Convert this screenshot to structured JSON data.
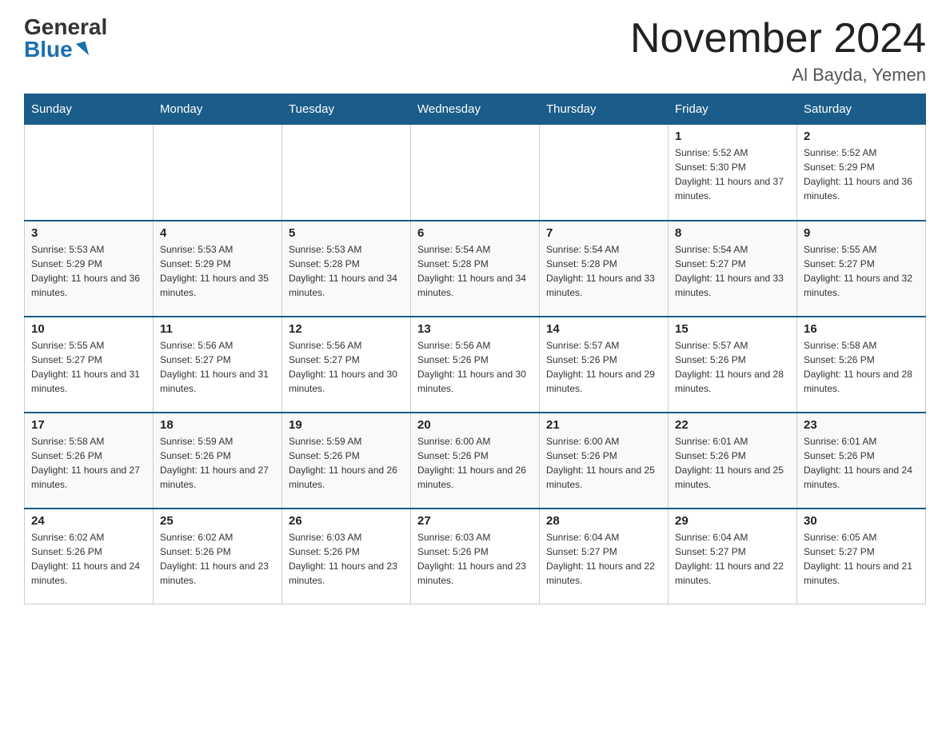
{
  "logo": {
    "general": "General",
    "blue": "Blue"
  },
  "title": "November 2024",
  "location": "Al Bayda, Yemen",
  "days_of_week": [
    "Sunday",
    "Monday",
    "Tuesday",
    "Wednesday",
    "Thursday",
    "Friday",
    "Saturday"
  ],
  "weeks": [
    [
      {
        "day": "",
        "sunrise": "",
        "sunset": "",
        "daylight": ""
      },
      {
        "day": "",
        "sunrise": "",
        "sunset": "",
        "daylight": ""
      },
      {
        "day": "",
        "sunrise": "",
        "sunset": "",
        "daylight": ""
      },
      {
        "day": "",
        "sunrise": "",
        "sunset": "",
        "daylight": ""
      },
      {
        "day": "",
        "sunrise": "",
        "sunset": "",
        "daylight": ""
      },
      {
        "day": "1",
        "sunrise": "Sunrise: 5:52 AM",
        "sunset": "Sunset: 5:30 PM",
        "daylight": "Daylight: 11 hours and 37 minutes."
      },
      {
        "day": "2",
        "sunrise": "Sunrise: 5:52 AM",
        "sunset": "Sunset: 5:29 PM",
        "daylight": "Daylight: 11 hours and 36 minutes."
      }
    ],
    [
      {
        "day": "3",
        "sunrise": "Sunrise: 5:53 AM",
        "sunset": "Sunset: 5:29 PM",
        "daylight": "Daylight: 11 hours and 36 minutes."
      },
      {
        "day": "4",
        "sunrise": "Sunrise: 5:53 AM",
        "sunset": "Sunset: 5:29 PM",
        "daylight": "Daylight: 11 hours and 35 minutes."
      },
      {
        "day": "5",
        "sunrise": "Sunrise: 5:53 AM",
        "sunset": "Sunset: 5:28 PM",
        "daylight": "Daylight: 11 hours and 34 minutes."
      },
      {
        "day": "6",
        "sunrise": "Sunrise: 5:54 AM",
        "sunset": "Sunset: 5:28 PM",
        "daylight": "Daylight: 11 hours and 34 minutes."
      },
      {
        "day": "7",
        "sunrise": "Sunrise: 5:54 AM",
        "sunset": "Sunset: 5:28 PM",
        "daylight": "Daylight: 11 hours and 33 minutes."
      },
      {
        "day": "8",
        "sunrise": "Sunrise: 5:54 AM",
        "sunset": "Sunset: 5:27 PM",
        "daylight": "Daylight: 11 hours and 33 minutes."
      },
      {
        "day": "9",
        "sunrise": "Sunrise: 5:55 AM",
        "sunset": "Sunset: 5:27 PM",
        "daylight": "Daylight: 11 hours and 32 minutes."
      }
    ],
    [
      {
        "day": "10",
        "sunrise": "Sunrise: 5:55 AM",
        "sunset": "Sunset: 5:27 PM",
        "daylight": "Daylight: 11 hours and 31 minutes."
      },
      {
        "day": "11",
        "sunrise": "Sunrise: 5:56 AM",
        "sunset": "Sunset: 5:27 PM",
        "daylight": "Daylight: 11 hours and 31 minutes."
      },
      {
        "day": "12",
        "sunrise": "Sunrise: 5:56 AM",
        "sunset": "Sunset: 5:27 PM",
        "daylight": "Daylight: 11 hours and 30 minutes."
      },
      {
        "day": "13",
        "sunrise": "Sunrise: 5:56 AM",
        "sunset": "Sunset: 5:26 PM",
        "daylight": "Daylight: 11 hours and 30 minutes."
      },
      {
        "day": "14",
        "sunrise": "Sunrise: 5:57 AM",
        "sunset": "Sunset: 5:26 PM",
        "daylight": "Daylight: 11 hours and 29 minutes."
      },
      {
        "day": "15",
        "sunrise": "Sunrise: 5:57 AM",
        "sunset": "Sunset: 5:26 PM",
        "daylight": "Daylight: 11 hours and 28 minutes."
      },
      {
        "day": "16",
        "sunrise": "Sunrise: 5:58 AM",
        "sunset": "Sunset: 5:26 PM",
        "daylight": "Daylight: 11 hours and 28 minutes."
      }
    ],
    [
      {
        "day": "17",
        "sunrise": "Sunrise: 5:58 AM",
        "sunset": "Sunset: 5:26 PM",
        "daylight": "Daylight: 11 hours and 27 minutes."
      },
      {
        "day": "18",
        "sunrise": "Sunrise: 5:59 AM",
        "sunset": "Sunset: 5:26 PM",
        "daylight": "Daylight: 11 hours and 27 minutes."
      },
      {
        "day": "19",
        "sunrise": "Sunrise: 5:59 AM",
        "sunset": "Sunset: 5:26 PM",
        "daylight": "Daylight: 11 hours and 26 minutes."
      },
      {
        "day": "20",
        "sunrise": "Sunrise: 6:00 AM",
        "sunset": "Sunset: 5:26 PM",
        "daylight": "Daylight: 11 hours and 26 minutes."
      },
      {
        "day": "21",
        "sunrise": "Sunrise: 6:00 AM",
        "sunset": "Sunset: 5:26 PM",
        "daylight": "Daylight: 11 hours and 25 minutes."
      },
      {
        "day": "22",
        "sunrise": "Sunrise: 6:01 AM",
        "sunset": "Sunset: 5:26 PM",
        "daylight": "Daylight: 11 hours and 25 minutes."
      },
      {
        "day": "23",
        "sunrise": "Sunrise: 6:01 AM",
        "sunset": "Sunset: 5:26 PM",
        "daylight": "Daylight: 11 hours and 24 minutes."
      }
    ],
    [
      {
        "day": "24",
        "sunrise": "Sunrise: 6:02 AM",
        "sunset": "Sunset: 5:26 PM",
        "daylight": "Daylight: 11 hours and 24 minutes."
      },
      {
        "day": "25",
        "sunrise": "Sunrise: 6:02 AM",
        "sunset": "Sunset: 5:26 PM",
        "daylight": "Daylight: 11 hours and 23 minutes."
      },
      {
        "day": "26",
        "sunrise": "Sunrise: 6:03 AM",
        "sunset": "Sunset: 5:26 PM",
        "daylight": "Daylight: 11 hours and 23 minutes."
      },
      {
        "day": "27",
        "sunrise": "Sunrise: 6:03 AM",
        "sunset": "Sunset: 5:26 PM",
        "daylight": "Daylight: 11 hours and 23 minutes."
      },
      {
        "day": "28",
        "sunrise": "Sunrise: 6:04 AM",
        "sunset": "Sunset: 5:27 PM",
        "daylight": "Daylight: 11 hours and 22 minutes."
      },
      {
        "day": "29",
        "sunrise": "Sunrise: 6:04 AM",
        "sunset": "Sunset: 5:27 PM",
        "daylight": "Daylight: 11 hours and 22 minutes."
      },
      {
        "day": "30",
        "sunrise": "Sunrise: 6:05 AM",
        "sunset": "Sunset: 5:27 PM",
        "daylight": "Daylight: 11 hours and 21 minutes."
      }
    ]
  ]
}
